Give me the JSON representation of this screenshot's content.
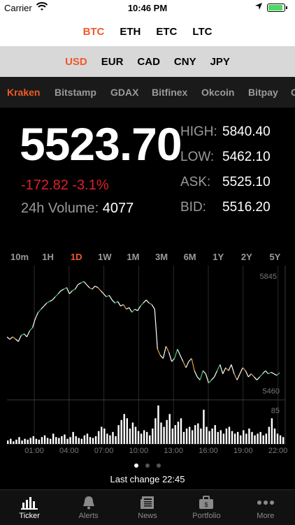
{
  "status": {
    "carrier": "Carrier",
    "time": "10:46 PM"
  },
  "coins": [
    "BTC",
    "ETH",
    "ETC",
    "LTC"
  ],
  "coin_active": "BTC",
  "fiats": [
    "USD",
    "EUR",
    "CAD",
    "CNY",
    "JPY"
  ],
  "fiat_active": "USD",
  "exchanges": [
    "Kraken",
    "Bitstamp",
    "GDAX",
    "Bitfinex",
    "Okcoin",
    "Bitpay",
    "C"
  ],
  "exchange_active": "Kraken",
  "ticker": {
    "price": "5523.70",
    "change": "-172.82  -3.1%",
    "volume_label": "24h Volume:",
    "volume": "4077",
    "high_label": "HIGH:",
    "high": "5840.40",
    "low_label": "LOW:",
    "low": "5462.10",
    "ask_label": "ASK:",
    "ask": "5525.10",
    "bid_label": "BID:",
    "bid": "5516.20"
  },
  "ranges": [
    "10m",
    "1H",
    "1D",
    "1W",
    "1M",
    "3M",
    "6M",
    "1Y",
    "2Y",
    "5Y"
  ],
  "range_active": "1D",
  "chart_data": {
    "type": "line",
    "x_ticks": [
      "01:00",
      "04:00",
      "07:00",
      "10:00",
      "13:00",
      "16:00",
      "19:00",
      "22:00"
    ],
    "y_ticks": [
      "5845",
      "5460"
    ],
    "volume_tick": "85",
    "ylim": [
      5440,
      5860
    ],
    "series": [
      {
        "values": [
          5640,
          5632,
          5640,
          5633,
          5625,
          5645,
          5650,
          5640,
          5660,
          5670,
          5700,
          5720,
          5730,
          5740,
          5750,
          5755,
          5760,
          5770,
          5780,
          5790,
          5795,
          5800,
          5780,
          5790,
          5795,
          5810,
          5815,
          5820,
          5810,
          5800,
          5795,
          5805,
          5800,
          5790,
          5780,
          5770,
          5775,
          5760,
          5750,
          5755,
          5740,
          5745,
          5730,
          5735,
          5720,
          5730,
          5725,
          5740,
          5750,
          5760,
          5750,
          5745,
          5730,
          5600,
          5580,
          5570,
          5610,
          5590,
          5560,
          5570,
          5600,
          5580,
          5560,
          5540,
          5560,
          5570,
          5530,
          5510,
          5500,
          5530,
          5520,
          5490,
          5500,
          5510,
          5530,
          5550,
          5520,
          5540,
          5530,
          5550,
          5520,
          5500,
          5520,
          5540,
          5530,
          5510,
          5520,
          5510,
          5500,
          5510,
          5520,
          5530,
          5520,
          5525,
          5520,
          5515,
          5523.7
        ]
      }
    ],
    "volume": [
      4,
      6,
      3,
      5,
      8,
      4,
      6,
      5,
      7,
      9,
      6,
      5,
      8,
      10,
      7,
      6,
      12,
      8,
      7,
      9,
      11,
      6,
      8,
      14,
      9,
      7,
      6,
      10,
      12,
      8,
      7,
      9,
      15,
      20,
      18,
      12,
      10,
      14,
      9,
      22,
      28,
      35,
      30,
      18,
      25,
      20,
      15,
      12,
      16,
      14,
      10,
      18,
      30,
      45,
      25,
      20,
      28,
      35,
      18,
      22,
      26,
      30,
      14,
      18,
      20,
      16,
      22,
      24,
      18,
      40,
      20,
      15,
      18,
      22,
      14,
      16,
      12,
      18,
      20,
      15,
      12,
      14,
      10,
      16,
      12,
      18,
      14,
      10,
      12,
      14,
      10,
      12,
      20,
      30,
      18,
      12,
      10,
      8
    ]
  },
  "page_dots": 3,
  "page_active": 0,
  "last_change_label": "Last change",
  "last_change_time": "22:45",
  "tabs": [
    {
      "label": "Ticker",
      "icon": "chart-bars-icon"
    },
    {
      "label": "Alerts",
      "icon": "bell-icon"
    },
    {
      "label": "News",
      "icon": "newspaper-icon"
    },
    {
      "label": "Portfolio",
      "icon": "briefcase-icon"
    },
    {
      "label": "More",
      "icon": "ellipsis-icon"
    }
  ],
  "tab_active": "Ticker",
  "colors": {
    "accent": "#ef5a28",
    "negative": "#e0202a",
    "line": "#ffffff",
    "line_up": "#3ccf6a",
    "line_down": "#e6a23c"
  }
}
